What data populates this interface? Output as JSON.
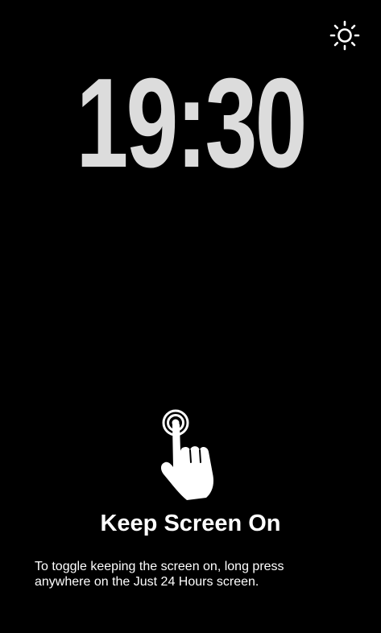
{
  "clock": {
    "time": "19:30"
  },
  "toolbar": {
    "brightness_icon": "brightness-icon"
  },
  "hint": {
    "icon": "long-press-hand-icon",
    "title": "Keep Screen On",
    "text": "To toggle keeping the screen on, long press anywhere on the Just 24 Hours screen."
  },
  "colors": {
    "background": "#000000",
    "clock_text": "#dcdcdc",
    "hint_text": "#ffffff"
  }
}
